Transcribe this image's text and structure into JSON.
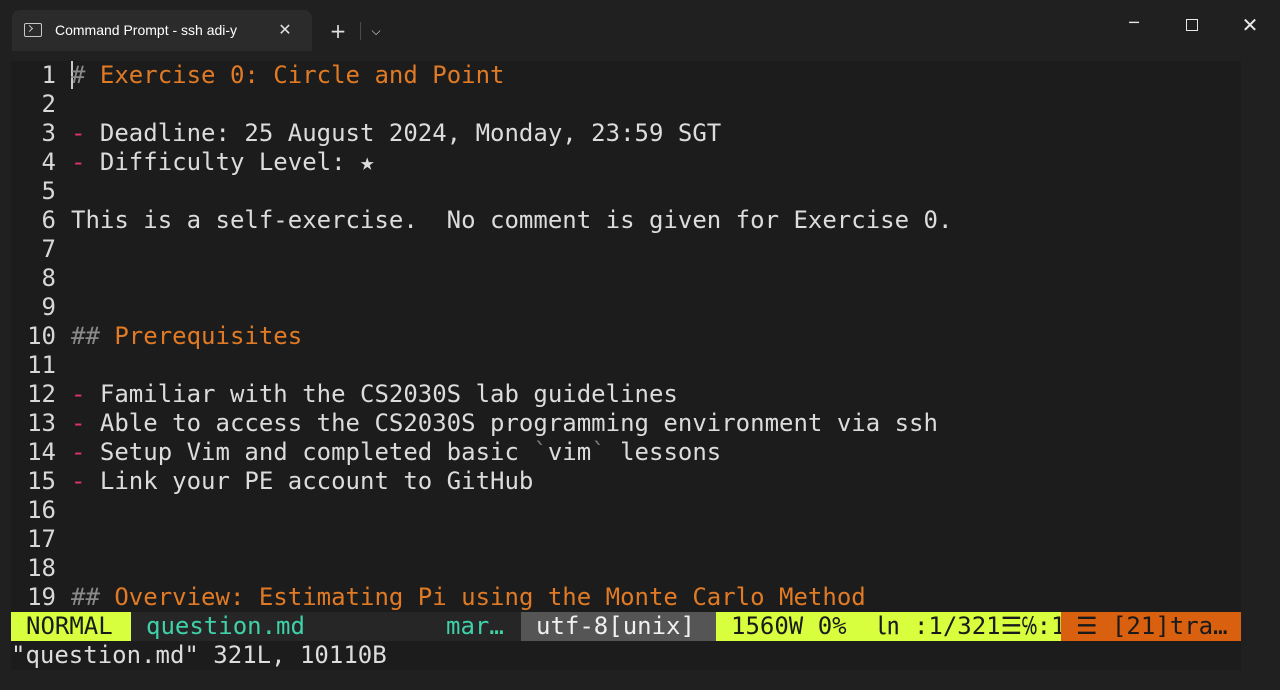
{
  "window": {
    "tab_title": "Command Prompt - ssh  adi-y",
    "tab_close": "✕",
    "new_tab": "+",
    "dropdown": "⌵",
    "minimize": "─",
    "close": "✕"
  },
  "editor": {
    "lines": [
      {
        "num": "1",
        "parts": [
          {
            "c": "hash",
            "t": "# "
          },
          {
            "c": "head",
            "t": "Exercise 0: Circle and Point"
          }
        ]
      },
      {
        "num": "2",
        "parts": []
      },
      {
        "num": "3",
        "parts": [
          {
            "c": "dash",
            "t": "-"
          },
          {
            "c": "",
            "t": " Deadline: 25 August 2024, Monday, 23:59 SGT"
          }
        ]
      },
      {
        "num": "4",
        "parts": [
          {
            "c": "dash",
            "t": "-"
          },
          {
            "c": "",
            "t": " Difficulty Level: ★"
          }
        ]
      },
      {
        "num": "5",
        "parts": []
      },
      {
        "num": "6",
        "parts": [
          {
            "c": "",
            "t": "This is a self-exercise.  No comment is given for Exercise 0."
          }
        ]
      },
      {
        "num": "7",
        "parts": []
      },
      {
        "num": "8",
        "parts": []
      },
      {
        "num": "9",
        "parts": []
      },
      {
        "num": "10",
        "parts": [
          {
            "c": "hash",
            "t": "## "
          },
          {
            "c": "head",
            "t": "Prerequisites"
          }
        ]
      },
      {
        "num": "11",
        "parts": []
      },
      {
        "num": "12",
        "parts": [
          {
            "c": "dash",
            "t": "-"
          },
          {
            "c": "",
            "t": " Familiar with the CS2030S lab guidelines"
          }
        ]
      },
      {
        "num": "13",
        "parts": [
          {
            "c": "dash",
            "t": "-"
          },
          {
            "c": "",
            "t": " Able to access the CS2030S programming environment via ssh"
          }
        ]
      },
      {
        "num": "14",
        "parts": [
          {
            "c": "dash",
            "t": "-"
          },
          {
            "c": "",
            "t": " Setup Vim and completed basic "
          },
          {
            "c": "tick",
            "t": "`"
          },
          {
            "c": "code",
            "t": "vim"
          },
          {
            "c": "tick",
            "t": "`"
          },
          {
            "c": "",
            "t": " lessons"
          }
        ]
      },
      {
        "num": "15",
        "parts": [
          {
            "c": "dash",
            "t": "-"
          },
          {
            "c": "",
            "t": " Link your PE account to GitHub"
          }
        ]
      },
      {
        "num": "16",
        "parts": []
      },
      {
        "num": "17",
        "parts": []
      },
      {
        "num": "18",
        "parts": []
      },
      {
        "num": "19",
        "parts": [
          {
            "c": "hash",
            "t": "## "
          },
          {
            "c": "head",
            "t": "Overview: Estimating Pi using the Monte Carlo Method"
          }
        ]
      }
    ]
  },
  "statusline": {
    "mode": "NORMAL",
    "filename": "question.md",
    "filetype": "mar…",
    "encoding": "utf-8[unix]",
    "position": "1560W 0%  ㏑ :1/321☰℅:1",
    "buffer": "☰ [21]tra…"
  },
  "cmdline": "\"question.md\" 321L, 10110B",
  "colors": {
    "heading": "#e07a25",
    "list_marker": "#e0336a",
    "mode_bg": "#d7ff3d",
    "filename": "#3fd1a8",
    "buffer_bg": "#d9600f"
  }
}
